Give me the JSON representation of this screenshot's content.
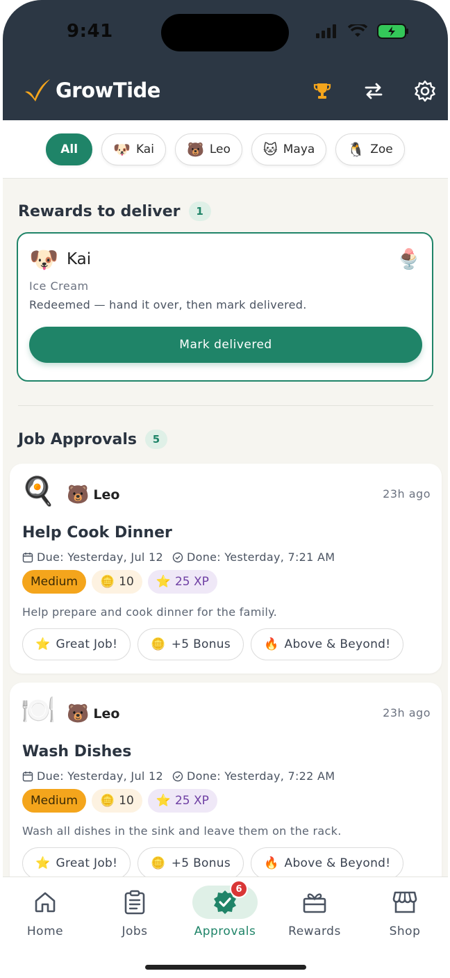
{
  "status_bar": {
    "time": "9:41"
  },
  "header": {
    "brand": "GrowTide",
    "icons": [
      "trophy-icon",
      "swap-icon",
      "gear-icon"
    ]
  },
  "filters": [
    {
      "label": "All",
      "emoji": ""
    },
    {
      "label": "Kai",
      "emoji": "🐶"
    },
    {
      "label": "Leo",
      "emoji": "🐻"
    },
    {
      "label": "Maya",
      "emoji": "🐱"
    },
    {
      "label": "Zoe",
      "emoji": "🐧"
    }
  ],
  "rewards_section": {
    "title": "Rewards to deliver",
    "count": "1",
    "card": {
      "kid_name": "Kai",
      "kid_emoji": "🐶",
      "reward_emoji": "🍨",
      "reward_name": "Ice Cream",
      "message": "Redeemed — hand it over, then mark delivered.",
      "button": "Mark delivered"
    }
  },
  "approvals_section": {
    "title": "Job Approvals",
    "count": "5",
    "jobs": [
      {
        "icon": "🍳",
        "kid_emoji": "🐻",
        "kid_name": "Leo",
        "ago": "23h ago",
        "title": "Help Cook Dinner",
        "due": "Due: Yesterday, Jul 12",
        "done": "Done: Yesterday, 7:21 AM",
        "difficulty": "Medium",
        "coins": "10",
        "xp": "25 XP",
        "description": "Help prepare and cook dinner for the family.",
        "actions": [
          "Great Job!",
          "+5 Bonus",
          "Above & Beyond!"
        ]
      },
      {
        "icon": "🍽️",
        "kid_emoji": "🐻",
        "kid_name": "Leo",
        "ago": "23h ago",
        "title": "Wash Dishes",
        "due": "Due: Yesterday, Jul 12",
        "done": "Done: Yesterday, 7:22 AM",
        "difficulty": "Medium",
        "coins": "10",
        "xp": "25 XP",
        "description": "Wash all dishes in the sink and leave them on the rack.",
        "actions": [
          "Great Job!",
          "+5 Bonus",
          "Above & Beyond!"
        ]
      }
    ]
  },
  "tabbar": {
    "tabs": [
      {
        "label": "Home",
        "icon": "home-icon"
      },
      {
        "label": "Jobs",
        "icon": "clipboard-icon"
      },
      {
        "label": "Approvals",
        "icon": "check-badge-icon",
        "badge": "6"
      },
      {
        "label": "Rewards",
        "icon": "gift-icon"
      },
      {
        "label": "Shop",
        "icon": "store-icon"
      }
    ],
    "active": "Approvals"
  },
  "colors": {
    "primary": "#1f8468",
    "header": "#2c3744",
    "medium": "#f4a51c",
    "xp": "#6e3fa3"
  }
}
